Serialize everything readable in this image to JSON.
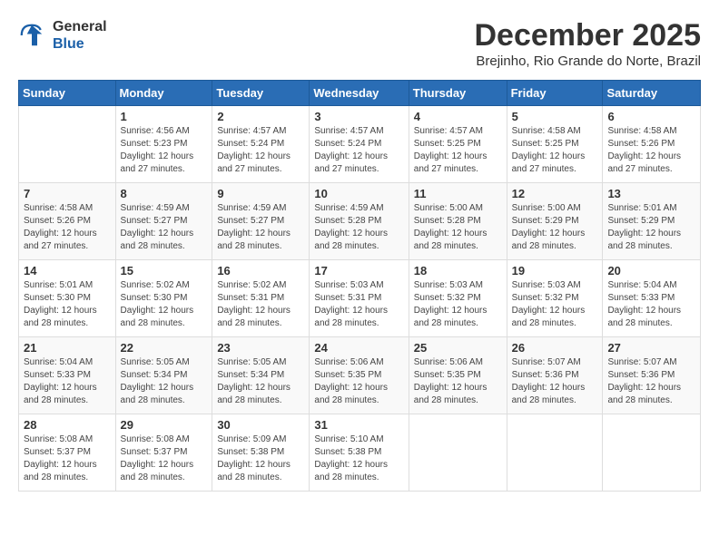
{
  "header": {
    "logo_line1": "General",
    "logo_line2": "Blue",
    "title": "December 2025",
    "subtitle": "Brejinho, Rio Grande do Norte, Brazil"
  },
  "days_of_week": [
    "Sunday",
    "Monday",
    "Tuesday",
    "Wednesday",
    "Thursday",
    "Friday",
    "Saturday"
  ],
  "weeks": [
    [
      {
        "day": "",
        "info": ""
      },
      {
        "day": "1",
        "info": "Sunrise: 4:56 AM\nSunset: 5:23 PM\nDaylight: 12 hours\nand 27 minutes."
      },
      {
        "day": "2",
        "info": "Sunrise: 4:57 AM\nSunset: 5:24 PM\nDaylight: 12 hours\nand 27 minutes."
      },
      {
        "day": "3",
        "info": "Sunrise: 4:57 AM\nSunset: 5:24 PM\nDaylight: 12 hours\nand 27 minutes."
      },
      {
        "day": "4",
        "info": "Sunrise: 4:57 AM\nSunset: 5:25 PM\nDaylight: 12 hours\nand 27 minutes."
      },
      {
        "day": "5",
        "info": "Sunrise: 4:58 AM\nSunset: 5:25 PM\nDaylight: 12 hours\nand 27 minutes."
      },
      {
        "day": "6",
        "info": "Sunrise: 4:58 AM\nSunset: 5:26 PM\nDaylight: 12 hours\nand 27 minutes."
      }
    ],
    [
      {
        "day": "7",
        "info": "Sunrise: 4:58 AM\nSunset: 5:26 PM\nDaylight: 12 hours\nand 27 minutes."
      },
      {
        "day": "8",
        "info": "Sunrise: 4:59 AM\nSunset: 5:27 PM\nDaylight: 12 hours\nand 28 minutes."
      },
      {
        "day": "9",
        "info": "Sunrise: 4:59 AM\nSunset: 5:27 PM\nDaylight: 12 hours\nand 28 minutes."
      },
      {
        "day": "10",
        "info": "Sunrise: 4:59 AM\nSunset: 5:28 PM\nDaylight: 12 hours\nand 28 minutes."
      },
      {
        "day": "11",
        "info": "Sunrise: 5:00 AM\nSunset: 5:28 PM\nDaylight: 12 hours\nand 28 minutes."
      },
      {
        "day": "12",
        "info": "Sunrise: 5:00 AM\nSunset: 5:29 PM\nDaylight: 12 hours\nand 28 minutes."
      },
      {
        "day": "13",
        "info": "Sunrise: 5:01 AM\nSunset: 5:29 PM\nDaylight: 12 hours\nand 28 minutes."
      }
    ],
    [
      {
        "day": "14",
        "info": "Sunrise: 5:01 AM\nSunset: 5:30 PM\nDaylight: 12 hours\nand 28 minutes."
      },
      {
        "day": "15",
        "info": "Sunrise: 5:02 AM\nSunset: 5:30 PM\nDaylight: 12 hours\nand 28 minutes."
      },
      {
        "day": "16",
        "info": "Sunrise: 5:02 AM\nSunset: 5:31 PM\nDaylight: 12 hours\nand 28 minutes."
      },
      {
        "day": "17",
        "info": "Sunrise: 5:03 AM\nSunset: 5:31 PM\nDaylight: 12 hours\nand 28 minutes."
      },
      {
        "day": "18",
        "info": "Sunrise: 5:03 AM\nSunset: 5:32 PM\nDaylight: 12 hours\nand 28 minutes."
      },
      {
        "day": "19",
        "info": "Sunrise: 5:03 AM\nSunset: 5:32 PM\nDaylight: 12 hours\nand 28 minutes."
      },
      {
        "day": "20",
        "info": "Sunrise: 5:04 AM\nSunset: 5:33 PM\nDaylight: 12 hours\nand 28 minutes."
      }
    ],
    [
      {
        "day": "21",
        "info": "Sunrise: 5:04 AM\nSunset: 5:33 PM\nDaylight: 12 hours\nand 28 minutes."
      },
      {
        "day": "22",
        "info": "Sunrise: 5:05 AM\nSunset: 5:34 PM\nDaylight: 12 hours\nand 28 minutes."
      },
      {
        "day": "23",
        "info": "Sunrise: 5:05 AM\nSunset: 5:34 PM\nDaylight: 12 hours\nand 28 minutes."
      },
      {
        "day": "24",
        "info": "Sunrise: 5:06 AM\nSunset: 5:35 PM\nDaylight: 12 hours\nand 28 minutes."
      },
      {
        "day": "25",
        "info": "Sunrise: 5:06 AM\nSunset: 5:35 PM\nDaylight: 12 hours\nand 28 minutes."
      },
      {
        "day": "26",
        "info": "Sunrise: 5:07 AM\nSunset: 5:36 PM\nDaylight: 12 hours\nand 28 minutes."
      },
      {
        "day": "27",
        "info": "Sunrise: 5:07 AM\nSunset: 5:36 PM\nDaylight: 12 hours\nand 28 minutes."
      }
    ],
    [
      {
        "day": "28",
        "info": "Sunrise: 5:08 AM\nSunset: 5:37 PM\nDaylight: 12 hours\nand 28 minutes."
      },
      {
        "day": "29",
        "info": "Sunrise: 5:08 AM\nSunset: 5:37 PM\nDaylight: 12 hours\nand 28 minutes."
      },
      {
        "day": "30",
        "info": "Sunrise: 5:09 AM\nSunset: 5:38 PM\nDaylight: 12 hours\nand 28 minutes."
      },
      {
        "day": "31",
        "info": "Sunrise: 5:10 AM\nSunset: 5:38 PM\nDaylight: 12 hours\nand 28 minutes."
      },
      {
        "day": "",
        "info": ""
      },
      {
        "day": "",
        "info": ""
      },
      {
        "day": "",
        "info": ""
      }
    ]
  ]
}
